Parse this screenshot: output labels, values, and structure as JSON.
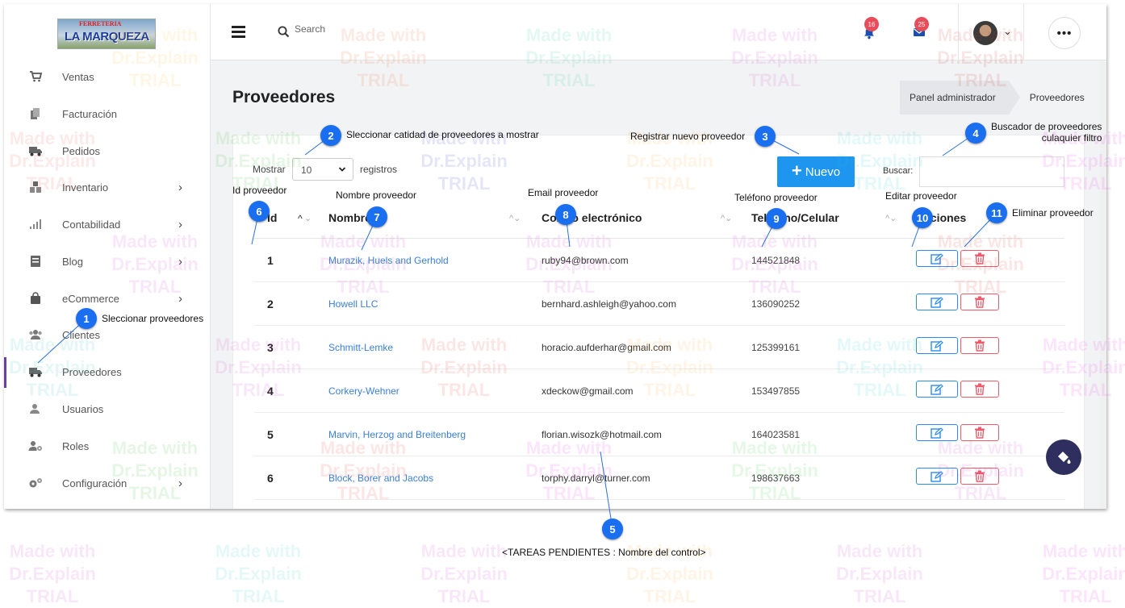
{
  "sidebar": {
    "logo_top": "FERRETERIA",
    "logo_name": "LA MARQUEZA",
    "items": [
      {
        "label": "Ventas",
        "icon": "cart-icon",
        "has_arrow": false
      },
      {
        "label": "Facturación",
        "icon": "copy-icon",
        "has_arrow": false
      },
      {
        "label": "Pedidos",
        "icon": "truck-icon",
        "has_arrow": false
      },
      {
        "label": "Inventario",
        "icon": "boxes-icon",
        "has_arrow": true
      },
      {
        "label": "Contabilidad",
        "icon": "signal-icon",
        "has_arrow": true
      },
      {
        "label": "Blog",
        "icon": "blog-icon",
        "has_arrow": true
      },
      {
        "label": "eCommerce",
        "icon": "bag-icon",
        "has_arrow": true
      },
      {
        "label": "Clientes",
        "icon": "users-icon",
        "has_arrow": false
      },
      {
        "label": "Proveedores",
        "icon": "truck-icon",
        "has_arrow": false,
        "active": true
      },
      {
        "label": "Usuarios",
        "icon": "user-icon",
        "has_arrow": false
      },
      {
        "label": "Roles",
        "icon": "user-gear-icon",
        "has_arrow": false
      },
      {
        "label": "Configuración",
        "icon": "gears-icon",
        "has_arrow": true
      }
    ],
    "arrow": "›"
  },
  "topbar": {
    "search_placeholder": "Search",
    "notifications_count": "16",
    "messages_count": "25",
    "more_label": "•••",
    "user_chevron": "⌄"
  },
  "page": {
    "title": "Proveedores",
    "breadcrumb": [
      "Panel administrador",
      "Proveedores"
    ]
  },
  "table_controls": {
    "show_label": "Mostrar",
    "page_size": "10",
    "records_label": "registros",
    "new_button": "Nuevo",
    "new_plus": "+",
    "search_label": "Buscar:"
  },
  "table": {
    "columns": [
      "Id",
      "Nombre",
      "Correo electrónico",
      "Teléfono/Celular",
      "Acciones"
    ],
    "rows": [
      {
        "id": "1",
        "name": "Murazik, Huels and Gerhold",
        "email": "ruby94@brown.com",
        "phone": "144521848"
      },
      {
        "id": "2",
        "name": "Howell LLC",
        "email": "bernhard.ashleigh@yahoo.com",
        "phone": "136090252"
      },
      {
        "id": "3",
        "name": "Schmitt-Lemke",
        "email": "horacio.aufderhar@gmail.com",
        "phone": "125399161"
      },
      {
        "id": "4",
        "name": "Corkery-Wehner",
        "email": "xdeckow@gmail.com",
        "phone": "153497855"
      },
      {
        "id": "5",
        "name": "Marvin, Herzog and Breitenberg",
        "email": "florian.wisozk@hotmail.com",
        "phone": "164023581"
      },
      {
        "id": "6",
        "name": "Block, Borer and Jacobs",
        "email": "torphy.darryl@turner.com",
        "phone": "198637663"
      }
    ]
  },
  "callouts": [
    {
      "n": "1",
      "label": "Sleccionar proveedores"
    },
    {
      "n": "2",
      "label": "Sleccionar catidad de proveedores a mostrar"
    },
    {
      "n": "3",
      "label": "Registrar nuevo proveedor"
    },
    {
      "n": "4",
      "label": "Buscador de proveedores\nculaquier filtro"
    },
    {
      "n": "5",
      "label": "<TAREAS PENDIENTES : Nombre del control>"
    },
    {
      "n": "6",
      "label": "Id proveedor"
    },
    {
      "n": "7",
      "label": "Nombre proveedor"
    },
    {
      "n": "8",
      "label": "Email proveedor"
    },
    {
      "n": "9",
      "label": "Teléfono proveedor"
    },
    {
      "n": "10",
      "label": "Editar proveedor"
    },
    {
      "n": "11",
      "label": "Eliminar proveedor"
    }
  ],
  "watermark": "Made with\nDr.Explain\nTRIAL",
  "colors": {
    "primary": "#1e96f0",
    "callout": "#1a6ff0",
    "danger": "#ee5a6a",
    "link": "#3b7fd4",
    "active_marker": "#6a3fa0",
    "fab": "#2e2f5e"
  }
}
